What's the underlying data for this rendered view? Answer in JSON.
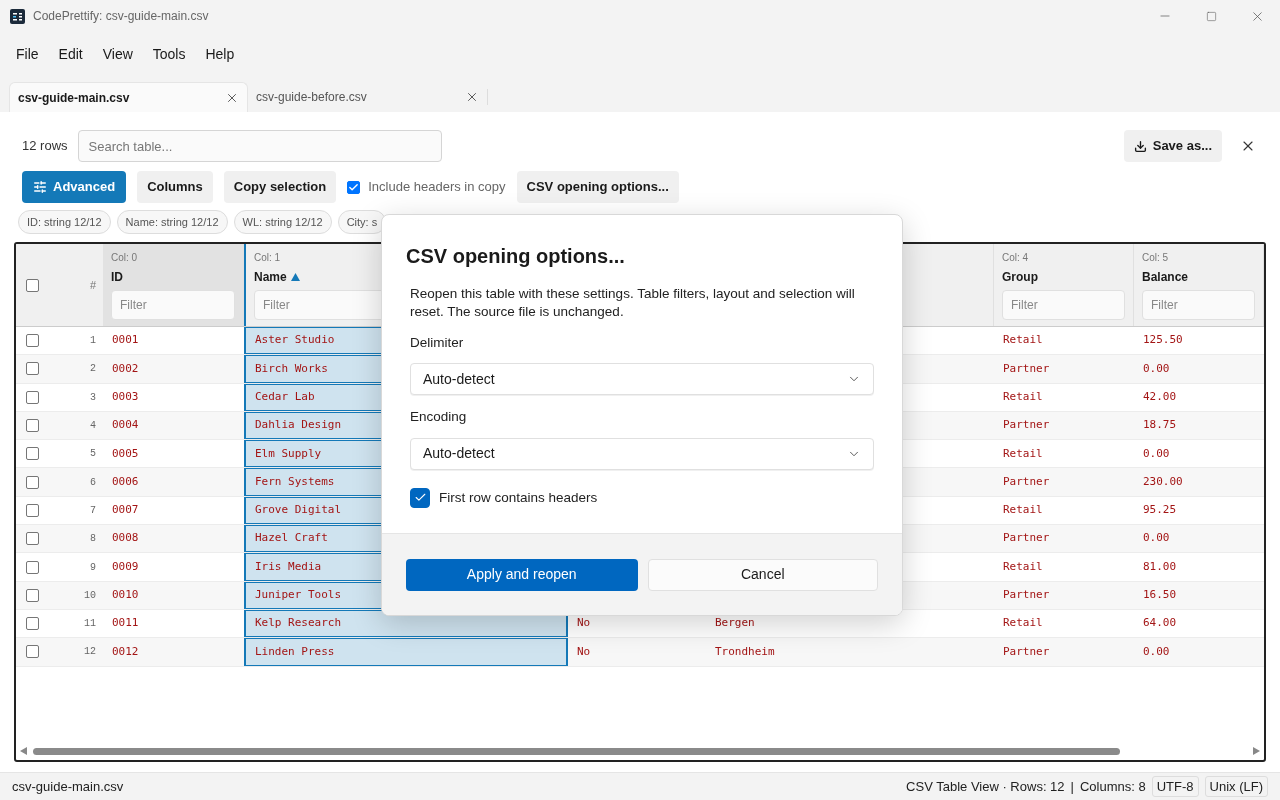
{
  "window": {
    "title": "CodePrettify: csv-guide-main.csv"
  },
  "menu": [
    "File",
    "Edit",
    "View",
    "Tools",
    "Help"
  ],
  "tabs": [
    {
      "label": "csv-guide-main.csv",
      "selected": true
    },
    {
      "label": "csv-guide-before.csv",
      "selected": false
    }
  ],
  "toolbar": {
    "row_count": "12 rows",
    "search": {
      "placeholder": "Search table..."
    },
    "save_button": "Save as...",
    "advanced": {
      "label": "Advanced",
      "on": true
    },
    "columns_button": "Columns",
    "copy_button": "Copy selection",
    "include_headers": {
      "label": "Include headers in copy",
      "checked": true
    },
    "csv_options_button": "CSV opening options..."
  },
  "chips": [
    "ID: string 12/12",
    "Name: string 12/12",
    "WL: string 12/12",
    "City: s"
  ],
  "table": {
    "all_checked": false,
    "number_header": "#",
    "columns": [
      {
        "index": "Col: 0",
        "name": "ID",
        "sorted": false,
        "selected": false,
        "filter_placeholder": "Filter"
      },
      {
        "index": "Col: 1",
        "name": "Name",
        "sorted": true,
        "selected": true,
        "filter_placeholder": "Filter"
      },
      {},
      {},
      {
        "index": "Col: 4",
        "name": "Group",
        "sorted": false,
        "selected": false,
        "filter_placeholder": "Filter"
      },
      {
        "index": "Col: 5",
        "name": "Balance",
        "sorted": false,
        "selected": false,
        "filter_placeholder": "Filter"
      }
    ],
    "rows": [
      {
        "number": "1",
        "checked": false,
        "cells": [
          "0001",
          "Aster Studio",
          null,
          null,
          "Retail",
          "125.50"
        ]
      },
      {
        "number": "2",
        "checked": false,
        "cells": [
          "0002",
          "Birch Works",
          null,
          null,
          "Partner",
          "0.00"
        ]
      },
      {
        "number": "3",
        "checked": false,
        "cells": [
          "0003",
          "Cedar Lab",
          null,
          null,
          "Retail",
          "42.00"
        ]
      },
      {
        "number": "4",
        "checked": false,
        "cells": [
          "0004",
          "Dahlia Design",
          null,
          null,
          "Partner",
          "18.75"
        ]
      },
      {
        "number": "5",
        "checked": false,
        "cells": [
          "0005",
          "Elm Supply",
          null,
          null,
          "Retail",
          "0.00"
        ]
      },
      {
        "number": "6",
        "checked": false,
        "cells": [
          "0006",
          "Fern Systems",
          null,
          null,
          "Partner",
          "230.00"
        ]
      },
      {
        "number": "7",
        "checked": false,
        "cells": [
          "0007",
          "Grove Digital",
          null,
          null,
          "Retail",
          "95.25"
        ]
      },
      {
        "number": "8",
        "checked": false,
        "cells": [
          "0008",
          "Hazel Craft",
          null,
          null,
          "Partner",
          "0.00"
        ]
      },
      {
        "number": "9",
        "checked": false,
        "cells": [
          "0009",
          "Iris Media",
          null,
          null,
          "Retail",
          "81.00"
        ]
      },
      {
        "number": "10",
        "checked": false,
        "cells": [
          "0010",
          "Juniper Tools",
          null,
          null,
          "Partner",
          "16.50"
        ]
      },
      {
        "number": "11",
        "checked": false,
        "cells": [
          "0011",
          "Kelp Research",
          "No",
          "Bergen",
          "Retail",
          "64.00"
        ]
      },
      {
        "number": "12",
        "checked": false,
        "cells": [
          "0012",
          "Linden Press",
          "No",
          "Trondheim",
          "Partner",
          "0.00"
        ]
      }
    ]
  },
  "dialog": {
    "title": "CSV opening options...",
    "description": "Reopen this table with these settings. Table filters, layout and selection will reset. The source file is unchanged.",
    "fields": [
      {
        "label": "Delimiter",
        "value": "Auto-detect"
      },
      {
        "label": "Encoding",
        "value": "Auto-detect"
      }
    ],
    "first_row_headers": {
      "label": "First row contains headers",
      "checked": true
    },
    "primary_button": "Apply and reopen",
    "cancel_button": "Cancel"
  },
  "status_bar": {
    "file": "csv-guide-main.csv",
    "view": "CSV Table View · Rows: 12",
    "separator": "|",
    "columns": "Columns: 8",
    "encoding": "UTF-8",
    "line_ending": "Unix (LF)"
  }
}
